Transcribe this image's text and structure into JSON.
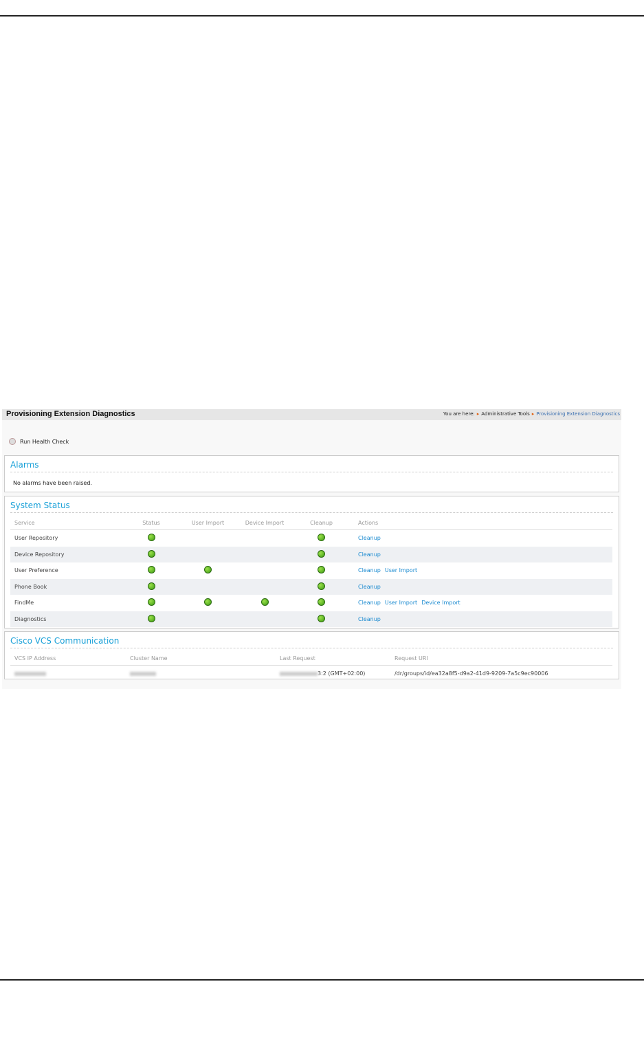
{
  "header": {
    "title": "Provisioning Extension Diagnostics",
    "breadcrumb": {
      "prefix": "You are here:",
      "items": [
        "Administrative Tools",
        "Provisioning Extension Diagnostics"
      ]
    }
  },
  "actions": {
    "run_health_check": "Run Health Check"
  },
  "alarms": {
    "title": "Alarms",
    "message": "No alarms have been raised."
  },
  "system_status": {
    "title": "System Status",
    "columns": [
      "Service",
      "Status",
      "User Import",
      "Device Import",
      "Cleanup",
      "Actions"
    ],
    "rows": [
      {
        "service": "User Repository",
        "status": true,
        "user_import": false,
        "device_import": false,
        "cleanup": true,
        "actions": [
          "Cleanup"
        ]
      },
      {
        "service": "Device Repository",
        "status": true,
        "user_import": false,
        "device_import": false,
        "cleanup": true,
        "actions": [
          "Cleanup"
        ]
      },
      {
        "service": "User Preference",
        "status": true,
        "user_import": true,
        "device_import": false,
        "cleanup": true,
        "actions": [
          "Cleanup",
          "User Import"
        ]
      },
      {
        "service": "Phone Book",
        "status": true,
        "user_import": false,
        "device_import": false,
        "cleanup": true,
        "actions": [
          "Cleanup"
        ]
      },
      {
        "service": "FindMe",
        "status": true,
        "user_import": true,
        "device_import": true,
        "cleanup": true,
        "actions": [
          "Cleanup",
          "User Import",
          "Device Import"
        ]
      },
      {
        "service": "Diagnostics",
        "status": true,
        "user_import": false,
        "device_import": false,
        "cleanup": true,
        "actions": [
          "Cleanup"
        ]
      }
    ]
  },
  "vcs": {
    "title": "Cisco VCS Communication",
    "columns": [
      "VCS IP Address",
      "Cluster Name",
      "Last Request",
      "Request URI"
    ],
    "row": {
      "last_request_suffix": "3:2 (GMT+02:00)",
      "request_uri": "/dr/groups/id/ea32a8f5-d9a2-41d9-9209-7a5c9ec90006"
    }
  },
  "colors": {
    "accent": "#18a0d8",
    "status_ok": "#4caf20"
  }
}
